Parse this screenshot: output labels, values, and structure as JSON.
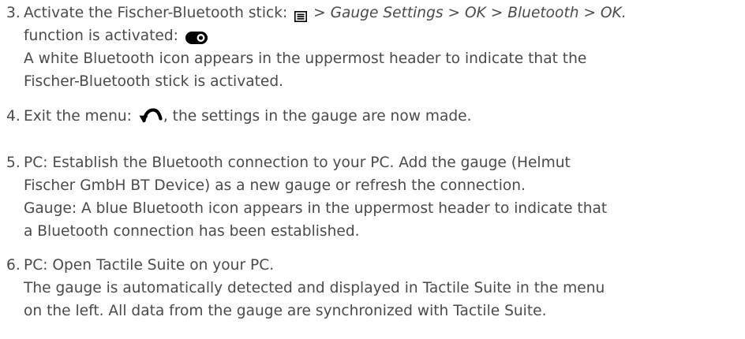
{
  "steps": [
    {
      "number": "3.",
      "line1_pre": "Activate the Fischer-Bluetooth stick: ",
      "line1_sep1": " > ",
      "line1_path1": "Gauge Settings",
      "line1_sep2": " > ",
      "line1_path2": "OK",
      "line1_sep3": " > ",
      "line1_path3": "Bluetooth",
      "line1_sep4": " > ",
      "line1_path4": "OK.",
      "line2": "function is activated: ",
      "line3": "A white Bluetooth icon appears in the uppermost header to indicate that the",
      "line4": "Fischer-Bluetooth stick is activated."
    },
    {
      "number": "4.",
      "line1_pre": "Exit the menu: ",
      "line1_post": ", the settings in the gauge are now made."
    },
    {
      "number": "5.",
      "line1": "PC: Establish the Bluetooth connection to your PC. Add the gauge (Helmut",
      "line2": "Fischer GmbH BT Device) as a new gauge or refresh the connection.",
      "line3": "Gauge: A blue Bluetooth icon appears in the uppermost header to indicate that",
      "line4": "a Bluetooth connection has been established."
    },
    {
      "number": "6.",
      "line1": "PC: Open Tactile Suite on your PC.",
      "line2": "The gauge is automatically detected and displayed in Tactile Suite in the menu",
      "line3": "on the left. All data from the gauge are synchronized with Tactile Suite."
    }
  ],
  "icons": {
    "menu": "menu-icon",
    "toggle": "toggle-on-icon",
    "back": "back-arrow-icon"
  },
  "colors": {
    "text": "#4a4a4a",
    "icon": "#000000"
  }
}
